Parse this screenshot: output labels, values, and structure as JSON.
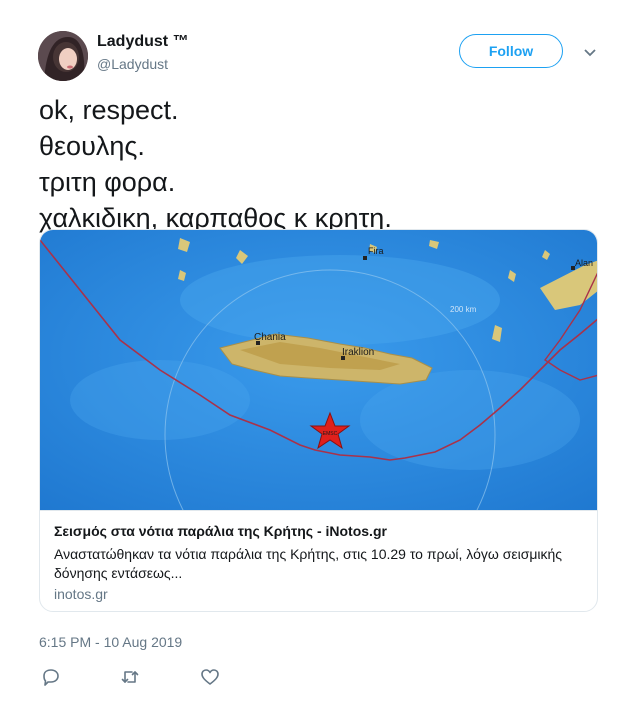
{
  "user": {
    "display_name": "Ladydust ™",
    "handle": "@Ladydust",
    "follow_label": "Follow"
  },
  "tweet": {
    "lines": [
      "ok, respect.",
      "θεουλης.",
      "τριτη φορα.",
      "χαλκιδικη, καρπαθος κ κρητη."
    ],
    "timestamp": "6:15 PM - 10 Aug 2019"
  },
  "card": {
    "title": "Σεισμός στα νότια παράλια της Κρήτης - iNotos.gr",
    "description": "Αναστατώθηκαν τα νότια παράλια της Κρήτης, στις 10.29 το πρωί, λόγω σεισμικής δόνησης εντάσεως...",
    "domain": "inotos.gr",
    "map": {
      "labels": {
        "fira": "Fira",
        "chania": "Chania",
        "iraklion": "Iraklion",
        "alan": "Alan",
        "distance": "200 km",
        "marker": "EMSC"
      }
    }
  },
  "actions": {
    "reply_icon": "reply-icon",
    "retweet_icon": "retweet-icon",
    "like_icon": "heart-icon"
  },
  "colors": {
    "accent": "#1da1f2",
    "secondary_text": "#657786",
    "border": "#e1e8ed",
    "sea": "#2e8fe0",
    "epicenter": "#e0201c"
  }
}
